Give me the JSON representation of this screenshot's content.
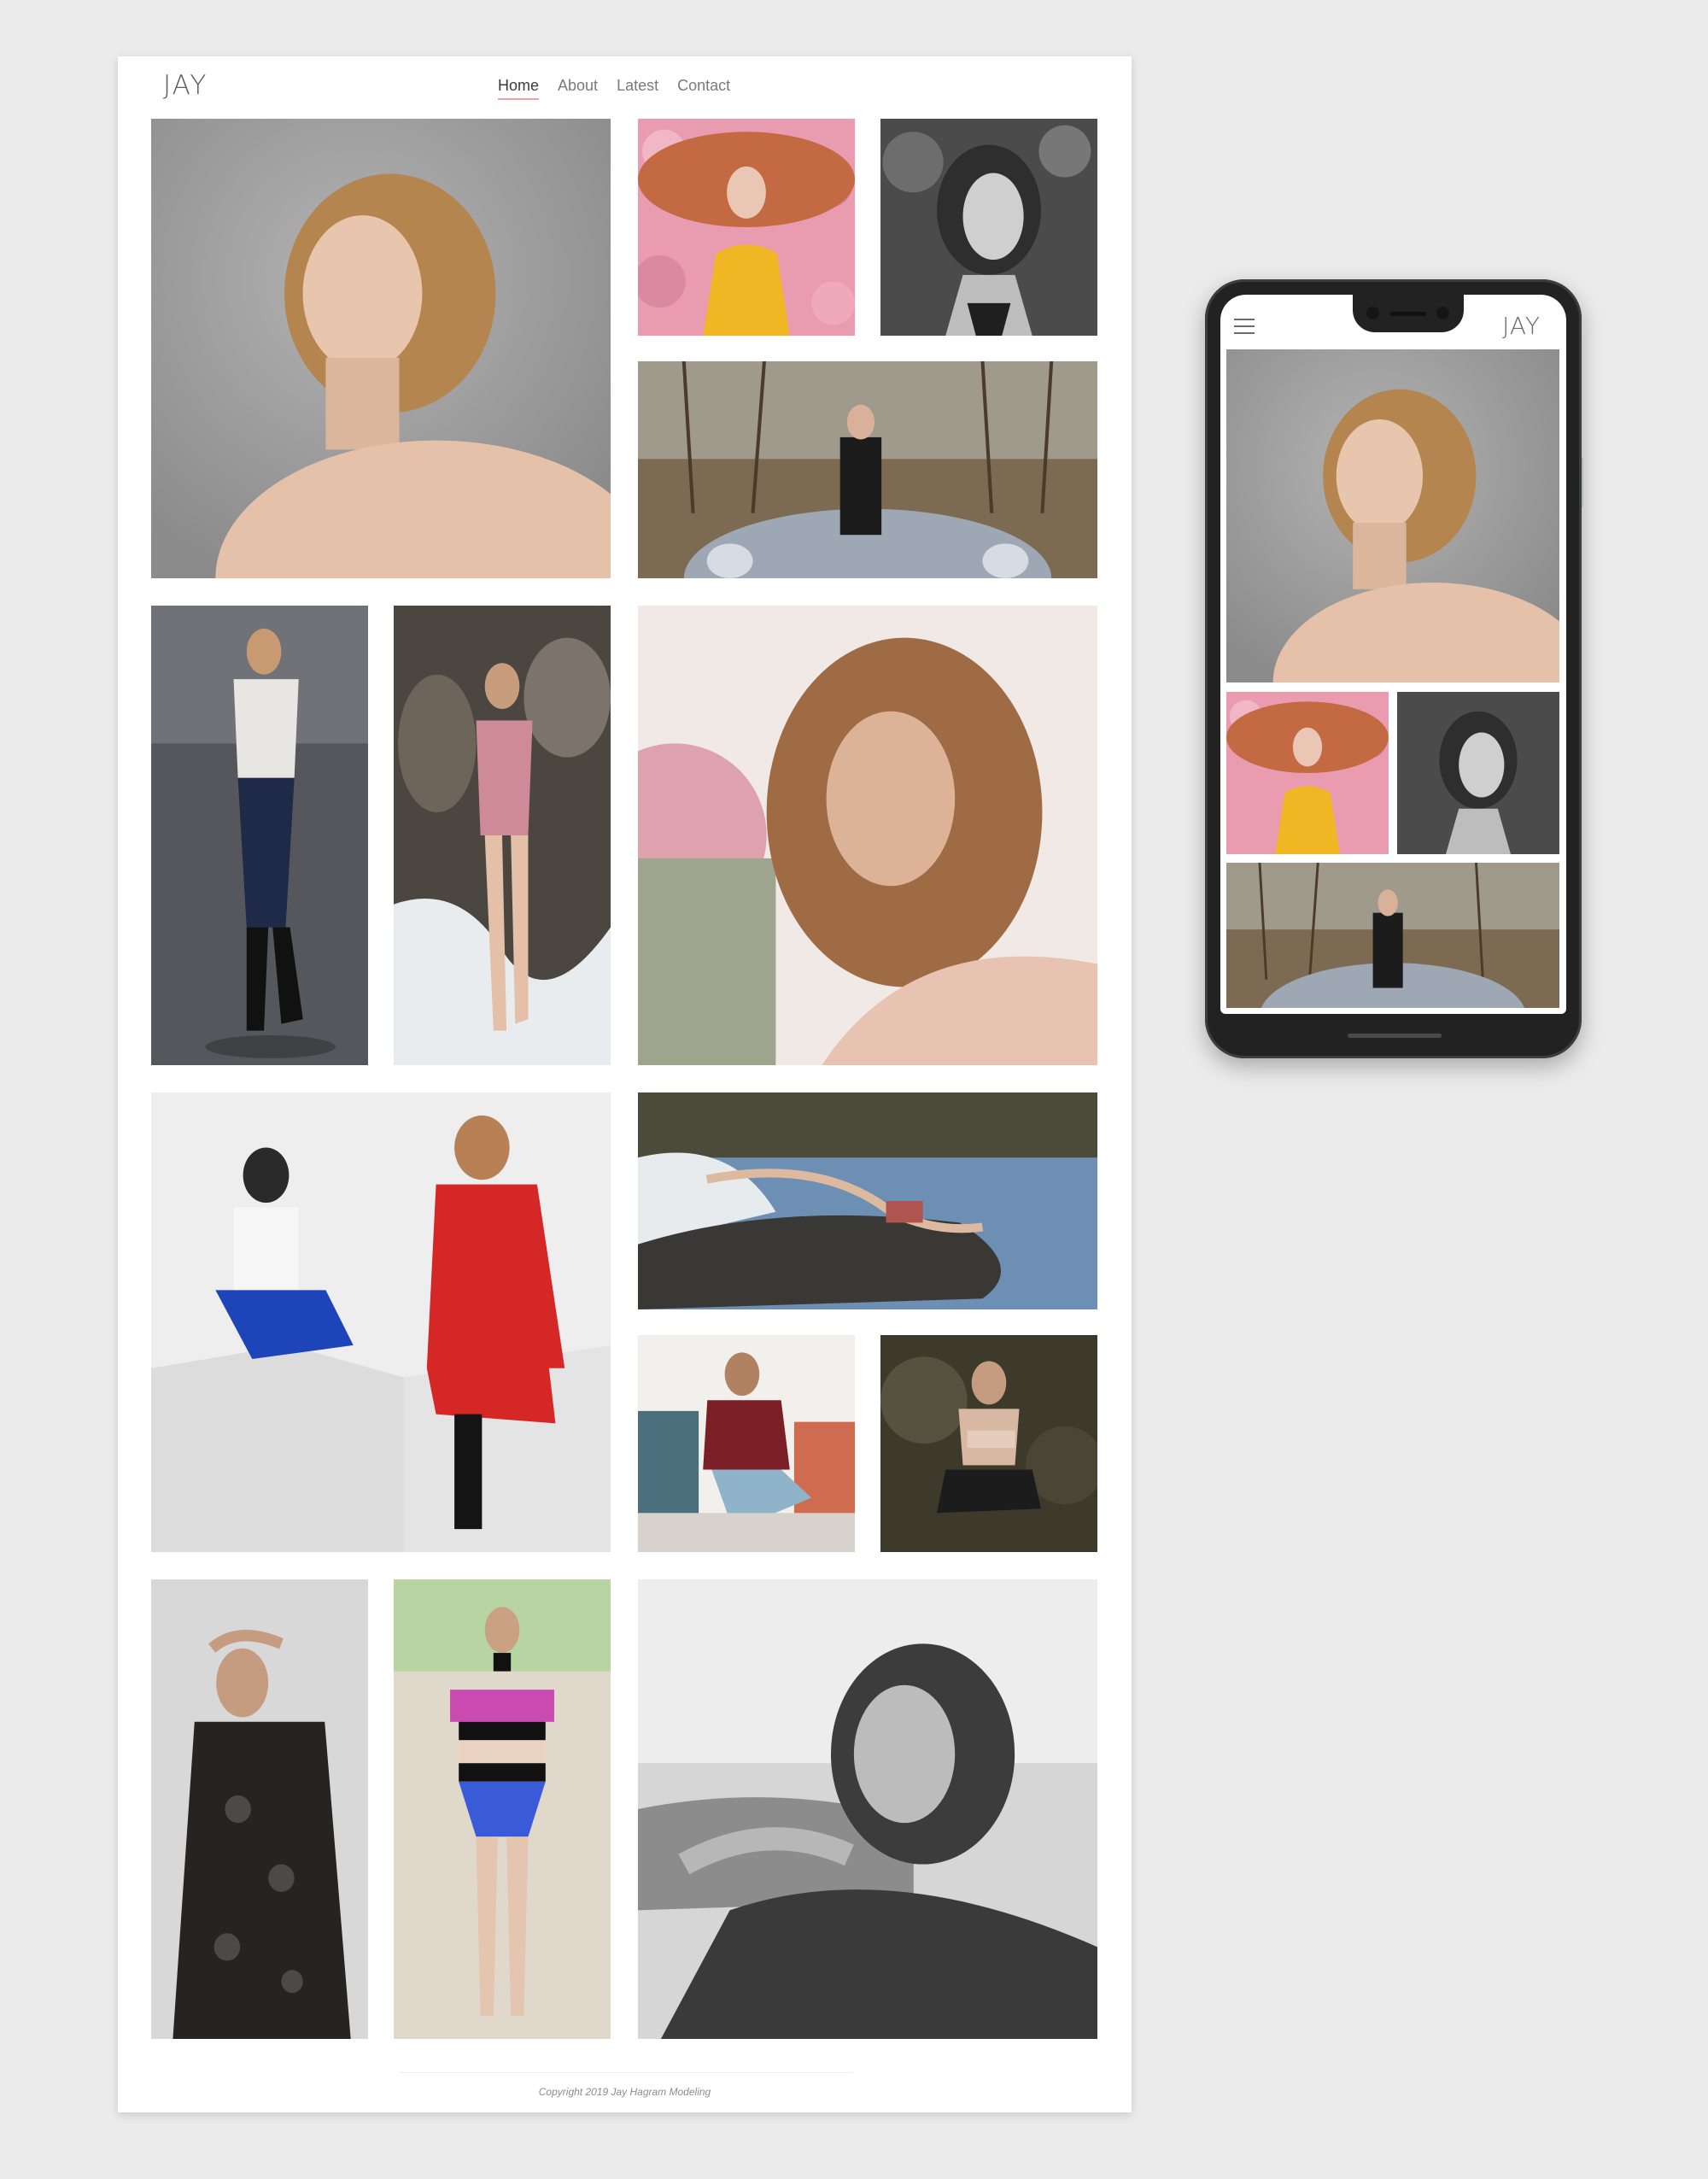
{
  "desktop": {
    "logo": "JAY",
    "nav": [
      {
        "label": "Home",
        "active": true
      },
      {
        "label": "About",
        "active": false
      },
      {
        "label": "Latest",
        "active": false
      },
      {
        "label": "Contact",
        "active": false
      }
    ],
    "footer": "Copyright 2019 Jay Hagram Modeling"
  },
  "mobile": {
    "logo": "JAY",
    "menu_icon": "hamburger-menu-icon"
  },
  "colors": {
    "page_bg": "#ebebeb",
    "nav_active_underline": "#e9a5a3",
    "text_muted": "#7a7a7a"
  }
}
